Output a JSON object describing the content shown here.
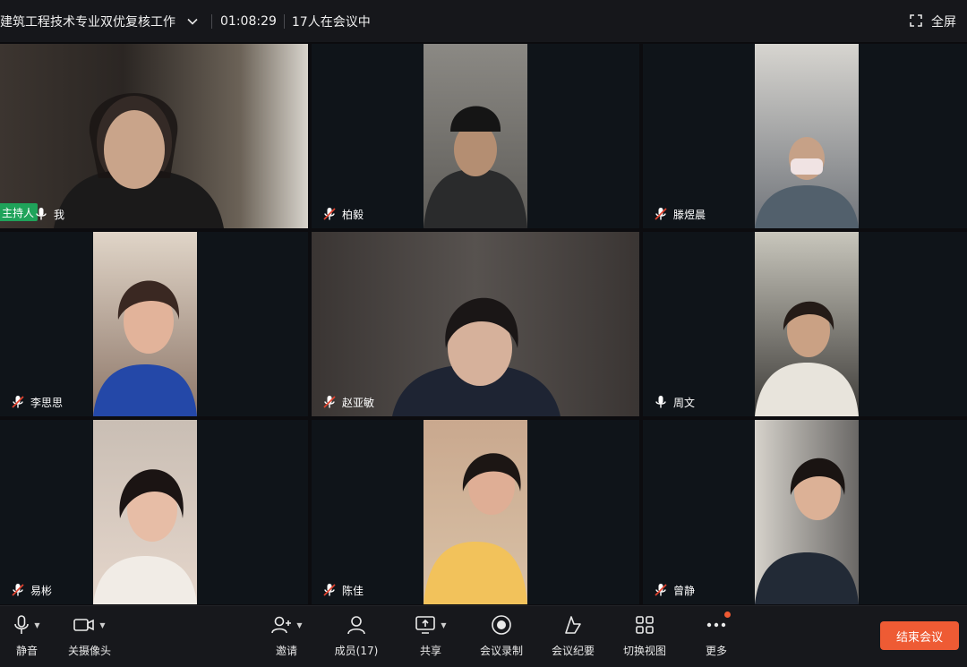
{
  "header": {
    "meeting_title": "建筑工程技术专业双优复核工作",
    "timer": "01:08:29",
    "participant_count": "17人在会议中",
    "fullscreen_label": "全屏"
  },
  "participants": [
    {
      "name": "我",
      "mic": "on",
      "host_label": "主持人",
      "bg": "#3d3730"
    },
    {
      "name": "柏毅",
      "mic": "muted",
      "bg": "#6d6a66"
    },
    {
      "name": "滕煜晨",
      "mic": "muted",
      "bg": "#4f5459"
    },
    {
      "name": "李思思",
      "mic": "muted",
      "bg": "#a88d78"
    },
    {
      "name": "赵亚敏",
      "mic": "muted",
      "bg": "#4a4746"
    },
    {
      "name": "周文",
      "mic": "on",
      "bg": "#6a6a62"
    },
    {
      "name": "易彬",
      "mic": "muted",
      "bg": "#b89f90"
    },
    {
      "name": "陈佳",
      "mic": "muted",
      "bg": "#c2a58c"
    },
    {
      "name": "曾静",
      "mic": "muted",
      "bg": "#8f8d89"
    }
  ],
  "toolbar": {
    "mute_label": "静音",
    "camera_label": "关摄像头",
    "invite_label": "邀请",
    "members_label": "成员(17)",
    "share_label": "共享",
    "record_label": "会议录制",
    "minutes_label": "会议纪要",
    "switch_view_label": "切换视图",
    "more_label": "更多",
    "end_label": "结束会议"
  },
  "colors": {
    "accent_end": "#ee5b34",
    "host_badge": "#1fa35a",
    "muted_red": "#e0432f"
  }
}
